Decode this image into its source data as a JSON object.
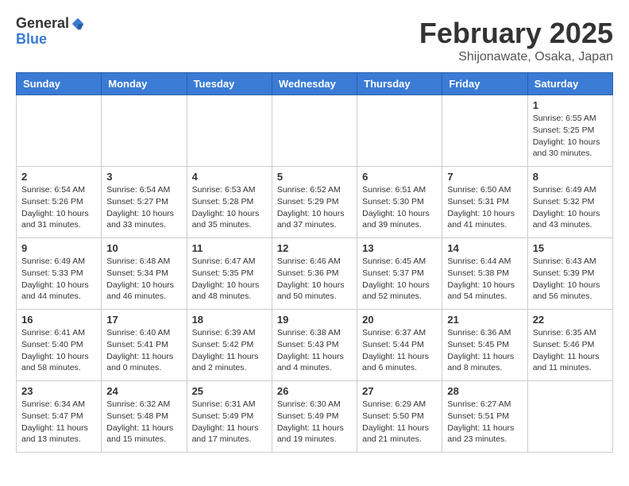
{
  "header": {
    "logo_general": "General",
    "logo_blue": "Blue",
    "title": "February 2025",
    "subtitle": "Shijonawate, Osaka, Japan"
  },
  "calendar": {
    "days_of_week": [
      "Sunday",
      "Monday",
      "Tuesday",
      "Wednesday",
      "Thursday",
      "Friday",
      "Saturday"
    ],
    "weeks": [
      [
        {
          "day": "",
          "info": ""
        },
        {
          "day": "",
          "info": ""
        },
        {
          "day": "",
          "info": ""
        },
        {
          "day": "",
          "info": ""
        },
        {
          "day": "",
          "info": ""
        },
        {
          "day": "",
          "info": ""
        },
        {
          "day": "1",
          "info": "Sunrise: 6:55 AM\nSunset: 5:25 PM\nDaylight: 10 hours\nand 30 minutes."
        }
      ],
      [
        {
          "day": "2",
          "info": "Sunrise: 6:54 AM\nSunset: 5:26 PM\nDaylight: 10 hours\nand 31 minutes."
        },
        {
          "day": "3",
          "info": "Sunrise: 6:54 AM\nSunset: 5:27 PM\nDaylight: 10 hours\nand 33 minutes."
        },
        {
          "day": "4",
          "info": "Sunrise: 6:53 AM\nSunset: 5:28 PM\nDaylight: 10 hours\nand 35 minutes."
        },
        {
          "day": "5",
          "info": "Sunrise: 6:52 AM\nSunset: 5:29 PM\nDaylight: 10 hours\nand 37 minutes."
        },
        {
          "day": "6",
          "info": "Sunrise: 6:51 AM\nSunset: 5:30 PM\nDaylight: 10 hours\nand 39 minutes."
        },
        {
          "day": "7",
          "info": "Sunrise: 6:50 AM\nSunset: 5:31 PM\nDaylight: 10 hours\nand 41 minutes."
        },
        {
          "day": "8",
          "info": "Sunrise: 6:49 AM\nSunset: 5:32 PM\nDaylight: 10 hours\nand 43 minutes."
        }
      ],
      [
        {
          "day": "9",
          "info": "Sunrise: 6:49 AM\nSunset: 5:33 PM\nDaylight: 10 hours\nand 44 minutes."
        },
        {
          "day": "10",
          "info": "Sunrise: 6:48 AM\nSunset: 5:34 PM\nDaylight: 10 hours\nand 46 minutes."
        },
        {
          "day": "11",
          "info": "Sunrise: 6:47 AM\nSunset: 5:35 PM\nDaylight: 10 hours\nand 48 minutes."
        },
        {
          "day": "12",
          "info": "Sunrise: 6:46 AM\nSunset: 5:36 PM\nDaylight: 10 hours\nand 50 minutes."
        },
        {
          "day": "13",
          "info": "Sunrise: 6:45 AM\nSunset: 5:37 PM\nDaylight: 10 hours\nand 52 minutes."
        },
        {
          "day": "14",
          "info": "Sunrise: 6:44 AM\nSunset: 5:38 PM\nDaylight: 10 hours\nand 54 minutes."
        },
        {
          "day": "15",
          "info": "Sunrise: 6:43 AM\nSunset: 5:39 PM\nDaylight: 10 hours\nand 56 minutes."
        }
      ],
      [
        {
          "day": "16",
          "info": "Sunrise: 6:41 AM\nSunset: 5:40 PM\nDaylight: 10 hours\nand 58 minutes."
        },
        {
          "day": "17",
          "info": "Sunrise: 6:40 AM\nSunset: 5:41 PM\nDaylight: 11 hours\nand 0 minutes."
        },
        {
          "day": "18",
          "info": "Sunrise: 6:39 AM\nSunset: 5:42 PM\nDaylight: 11 hours\nand 2 minutes."
        },
        {
          "day": "19",
          "info": "Sunrise: 6:38 AM\nSunset: 5:43 PM\nDaylight: 11 hours\nand 4 minutes."
        },
        {
          "day": "20",
          "info": "Sunrise: 6:37 AM\nSunset: 5:44 PM\nDaylight: 11 hours\nand 6 minutes."
        },
        {
          "day": "21",
          "info": "Sunrise: 6:36 AM\nSunset: 5:45 PM\nDaylight: 11 hours\nand 8 minutes."
        },
        {
          "day": "22",
          "info": "Sunrise: 6:35 AM\nSunset: 5:46 PM\nDaylight: 11 hours\nand 11 minutes."
        }
      ],
      [
        {
          "day": "23",
          "info": "Sunrise: 6:34 AM\nSunset: 5:47 PM\nDaylight: 11 hours\nand 13 minutes."
        },
        {
          "day": "24",
          "info": "Sunrise: 6:32 AM\nSunset: 5:48 PM\nDaylight: 11 hours\nand 15 minutes."
        },
        {
          "day": "25",
          "info": "Sunrise: 6:31 AM\nSunset: 5:49 PM\nDaylight: 11 hours\nand 17 minutes."
        },
        {
          "day": "26",
          "info": "Sunrise: 6:30 AM\nSunset: 5:49 PM\nDaylight: 11 hours\nand 19 minutes."
        },
        {
          "day": "27",
          "info": "Sunrise: 6:29 AM\nSunset: 5:50 PM\nDaylight: 11 hours\nand 21 minutes."
        },
        {
          "day": "28",
          "info": "Sunrise: 6:27 AM\nSunset: 5:51 PM\nDaylight: 11 hours\nand 23 minutes."
        },
        {
          "day": "",
          "info": ""
        }
      ]
    ]
  }
}
